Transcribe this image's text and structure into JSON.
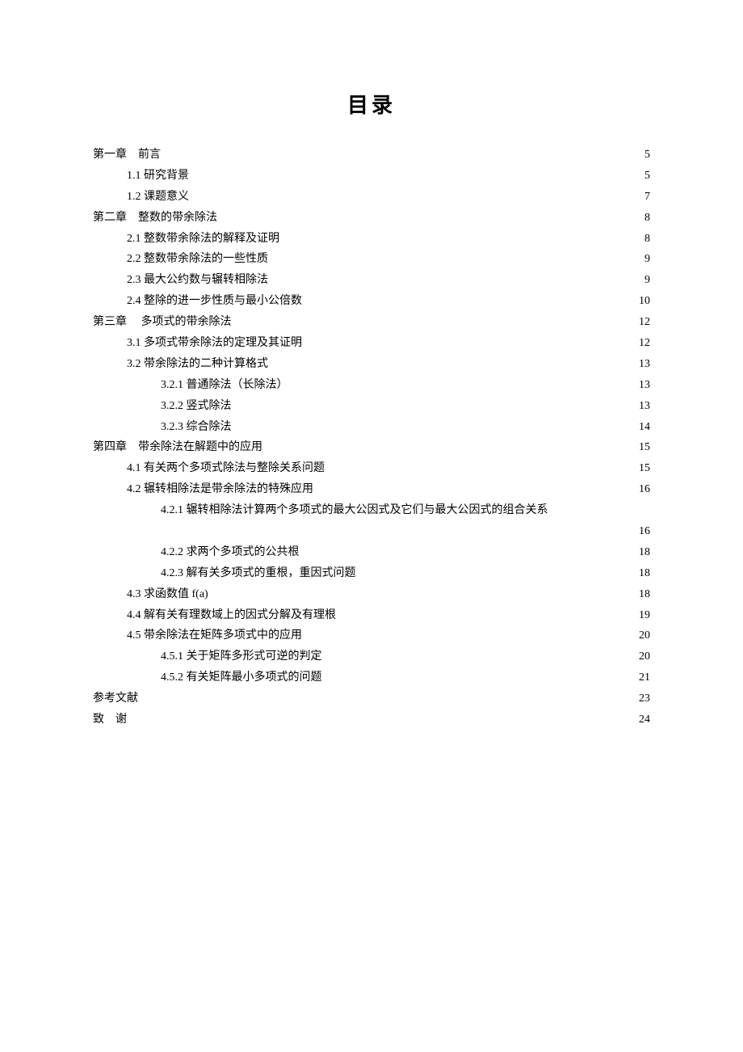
{
  "title": "目录",
  "entries": [
    {
      "label": "第一章　前言",
      "page": "5",
      "level": 0
    },
    {
      "label": "1.1 研究背景",
      "page": "5",
      "level": 1
    },
    {
      "label": "1.2 课题意义",
      "page": "7",
      "level": 1
    },
    {
      "label": "第二章　整数的带余除法",
      "page": "8",
      "level": 0
    },
    {
      "label": "2.1 整数带余除法的解释及证明",
      "page": "8",
      "level": 1
    },
    {
      "label": "2.2 整数带余除法的一些性质",
      "page": "9",
      "level": 1
    },
    {
      "label": "2.3 最大公约数与辗转相除法",
      "page": "9",
      "level": 1
    },
    {
      "label": "2.4 整除的进一步性质与最小公倍数",
      "page": "10",
      "level": 1
    },
    {
      "label": "第三章　 多项式的带余除法",
      "page": "12",
      "level": 0
    },
    {
      "label": "3.1 多项式带余除法的定理及其证明",
      "page": "12",
      "level": 1
    },
    {
      "label": "3.2 带余除法的二种计算格式",
      "page": "13",
      "level": 1
    },
    {
      "label": "3.2.1 普通除法（长除法）",
      "page": "13",
      "level": 2
    },
    {
      "label": "3.2.2 竖式除法",
      "page": "13",
      "level": 2
    },
    {
      "label": "3.2.3 综合除法",
      "page": "14",
      "level": 2
    },
    {
      "label": "第四章　带余除法在解题中的应用",
      "page": "15",
      "level": 0
    },
    {
      "label": "4.1 有关两个多项式除法与整除关系问题",
      "page": "15",
      "level": 1
    },
    {
      "label": "4.2 辗转相除法是带余除法的特殊应用",
      "page": "16",
      "level": 1
    },
    {
      "label": "4.2.1 辗转相除法计算两个多项式的最大公因式及它们与最大公因式的组合关系",
      "page": "",
      "level": 2,
      "nodots": true
    },
    {
      "label": "",
      "page": "16",
      "level": 3
    },
    {
      "label": "4.2.2 求两个多项式的公共根",
      "page": "18",
      "level": 2
    },
    {
      "label": "4.2.3 解有关多项式的重根，重因式问题",
      "page": "18",
      "level": 2
    },
    {
      "label": "4.3 求函数值 f(a)",
      "page": "18",
      "level": 1
    },
    {
      "label": "4.4 解有关有理数域上的因式分解及有理根",
      "page": "19",
      "level": 1
    },
    {
      "label": "4.5 带余除法在矩阵多项式中的应用",
      "page": "20",
      "level": 1
    },
    {
      "label": "4.5.1 关于矩阵多形式可逆的判定",
      "page": "20",
      "level": 2
    },
    {
      "label": "4.5.2 有关矩阵最小多项式的问题",
      "page": "21",
      "level": 2
    },
    {
      "label": "参考文献",
      "page": "23",
      "level": 0
    },
    {
      "label": "致　谢",
      "page": "24",
      "level": 0
    }
  ]
}
